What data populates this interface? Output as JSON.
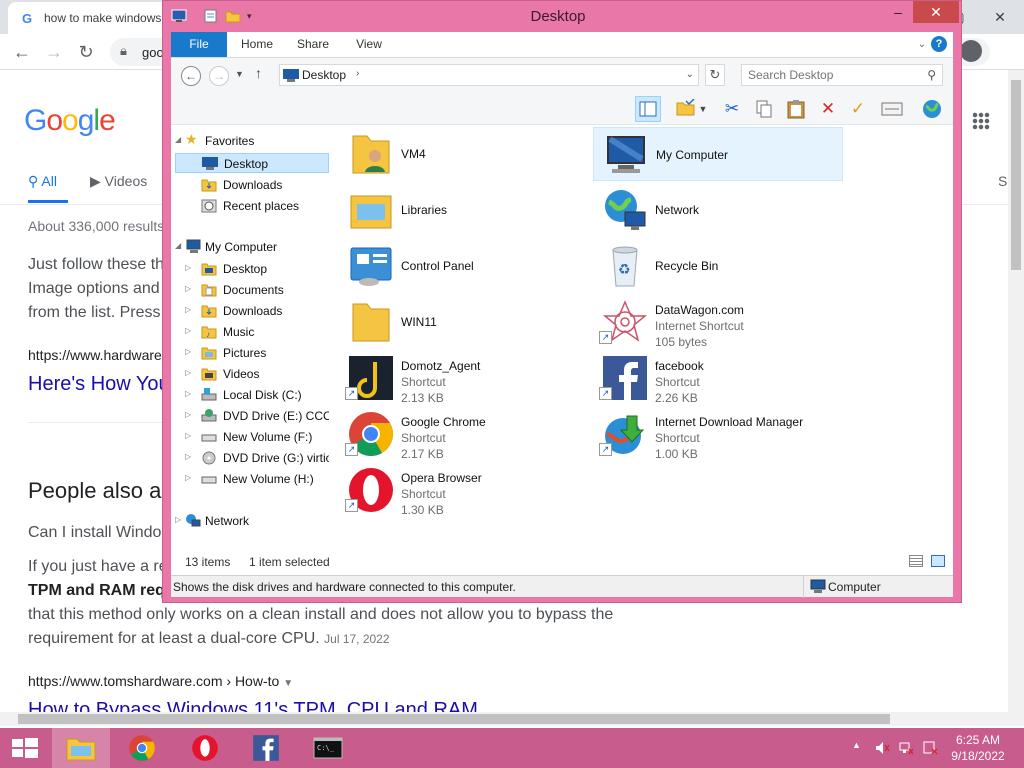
{
  "browser": {
    "tab_title": "how to make windows",
    "url_partial": "goo",
    "google_letters": [
      "G",
      "o",
      "o",
      "g",
      "l",
      "e"
    ],
    "search_tabs": [
      "All",
      "Videos"
    ],
    "search_tab_overflow": "S",
    "result_stats": "About 336,000 results",
    "snippet_lines": [
      "Just follow these th",
      "Image options and",
      "from the list. Press"
    ],
    "result1_url": "https://www.hardware",
    "result1_link": "Here's How You",
    "people_also_ask": "People also a",
    "question1": "Can I install Windo",
    "para_line1": "If you just have a re",
    "para_bold": "TPM and RAM req",
    "para_line3": "that this method only works on a clean install and does not allow you to bypass the",
    "para_line4": "requirement for at least a dual-core CPU.",
    "para_date": "Jul 17, 2022",
    "result2_url": "https://www.tomshardware.com › How-to",
    "result2_link": "How to Bypass Windows 11's TPM, CPU and RAM"
  },
  "explorer": {
    "title": "Desktop",
    "ribbon_tabs": [
      "File",
      "Home",
      "Share",
      "View"
    ],
    "address_text": "Desktop",
    "search_placeholder": "Search Desktop",
    "nav": {
      "favorites": "Favorites",
      "favorites_items": [
        "Desktop",
        "Downloads",
        "Recent places"
      ],
      "my_computer": "My Computer",
      "my_computer_items": [
        "Desktop",
        "Documents",
        "Downloads",
        "Music",
        "Pictures",
        "Videos",
        "Local Disk (C:)",
        "DVD Drive (E:) CCCC",
        "New Volume (F:)",
        "DVD Drive (G:) virtio",
        "New Volume (H:)"
      ],
      "network": "Network"
    },
    "items_left": [
      {
        "name": "VM4",
        "type": "",
        "size": "",
        "icon": "user-folder-icon"
      },
      {
        "name": "Libraries",
        "type": "",
        "size": "",
        "icon": "libraries-icon"
      },
      {
        "name": "Control Panel",
        "type": "",
        "size": "",
        "icon": "control-panel-icon"
      },
      {
        "name": "WIN11",
        "type": "",
        "size": "",
        "icon": "folder-icon"
      },
      {
        "name": "Domotz_Agent",
        "type": "Shortcut",
        "size": "2.13 KB",
        "icon": "domotz-icon"
      },
      {
        "name": "Google Chrome",
        "type": "Shortcut",
        "size": "2.17 KB",
        "icon": "chrome-icon"
      },
      {
        "name": "Opera Browser",
        "type": "Shortcut",
        "size": "1.30 KB",
        "icon": "opera-icon"
      }
    ],
    "items_right": [
      {
        "name": "My Computer",
        "type": "",
        "size": "",
        "icon": "computer-icon"
      },
      {
        "name": "Network",
        "type": "",
        "size": "",
        "icon": "network-icon"
      },
      {
        "name": "Recycle Bin",
        "type": "",
        "size": "",
        "icon": "recycle-bin-icon"
      },
      {
        "name": "DataWagon.com",
        "type": "Internet Shortcut",
        "size": "105 bytes",
        "icon": "datawagon-icon"
      },
      {
        "name": "facebook",
        "type": "Shortcut",
        "size": "2.26 KB",
        "icon": "facebook-icon"
      },
      {
        "name": "Internet Download Manager",
        "type": "Shortcut",
        "size": "1.00 KB",
        "icon": "idm-icon"
      }
    ],
    "item_count": "13 items",
    "selection": "1 item selected",
    "status_message": "Shows the disk drives and hardware connected to this computer.",
    "status_zone": "Computer"
  },
  "taskbar": {
    "time": "6:25 AM",
    "date": "9/18/2022",
    "color": "#c85c8d"
  }
}
